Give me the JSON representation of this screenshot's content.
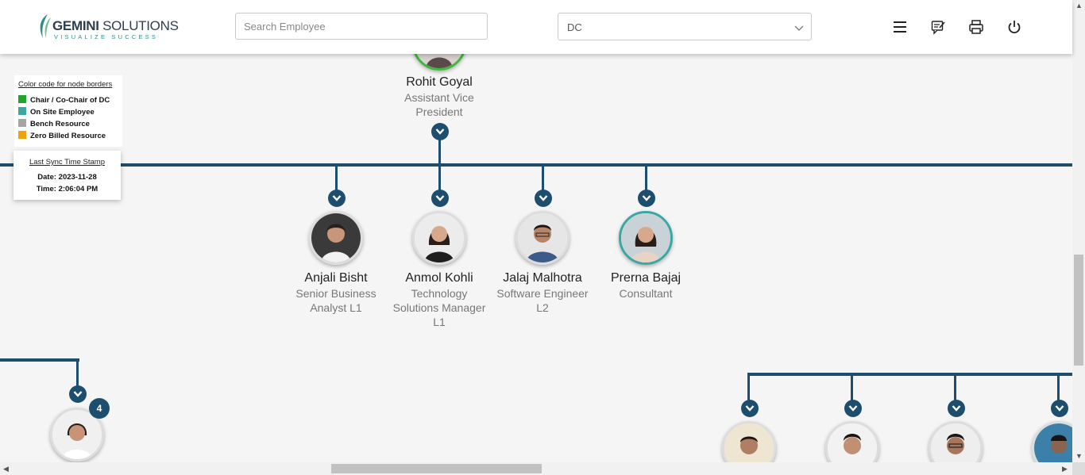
{
  "header": {
    "logo_brand_bold": "GEMINI",
    "logo_brand_rest": " SOLUTIONS",
    "logo_tagline": "VISUALIZE SUCCESS",
    "search_placeholder": "Search Employee",
    "dropdown_value": "DC",
    "icons": [
      "menu-icon",
      "feedback-icon",
      "print-icon",
      "power-icon"
    ]
  },
  "legend": {
    "title": "Color code for node borders",
    "items": [
      {
        "label": "Chair / Co-Chair of DC",
        "color": "#1fa62a"
      },
      {
        "label": "On Site Employee",
        "color": "#3aa6a6"
      },
      {
        "label": "Bench Resource",
        "color": "#a5a5a5"
      },
      {
        "label": "Zero Billed Resource",
        "color": "#f0a20a"
      }
    ]
  },
  "sync": {
    "title": "Last Sync Time Stamp",
    "date_line": "Date: 2023-11-28",
    "time_line": "Time: 2:06:04 PM"
  },
  "tree": {
    "parent": {
      "name": "Rohit Goyal",
      "role_line1": "Assistant Vice",
      "role_line2": "President",
      "border": "#3db83a"
    },
    "children": [
      {
        "name": "Anjali Bisht",
        "role_line1": "Senior Business",
        "role_line2": "Analyst L1",
        "role_line3": "",
        "border": "#dddddd"
      },
      {
        "name": "Anmol Kohli",
        "role_line1": "Technology",
        "role_line2": "Solutions Manager",
        "role_line3": "L1",
        "border": "#dddddd"
      },
      {
        "name": "Jalaj Malhotra",
        "role_line1": "Software Engineer",
        "role_line2": "L2",
        "role_line3": "",
        "border": "#dddddd"
      },
      {
        "name": "Prerna Bajaj",
        "role_line1": "Consultant",
        "role_line2": "",
        "role_line3": "",
        "border": "#3aa6a6"
      }
    ],
    "left_node_badge": "4"
  },
  "colors": {
    "accent": "#1e4e6e",
    "background": "#f5f5f5"
  }
}
